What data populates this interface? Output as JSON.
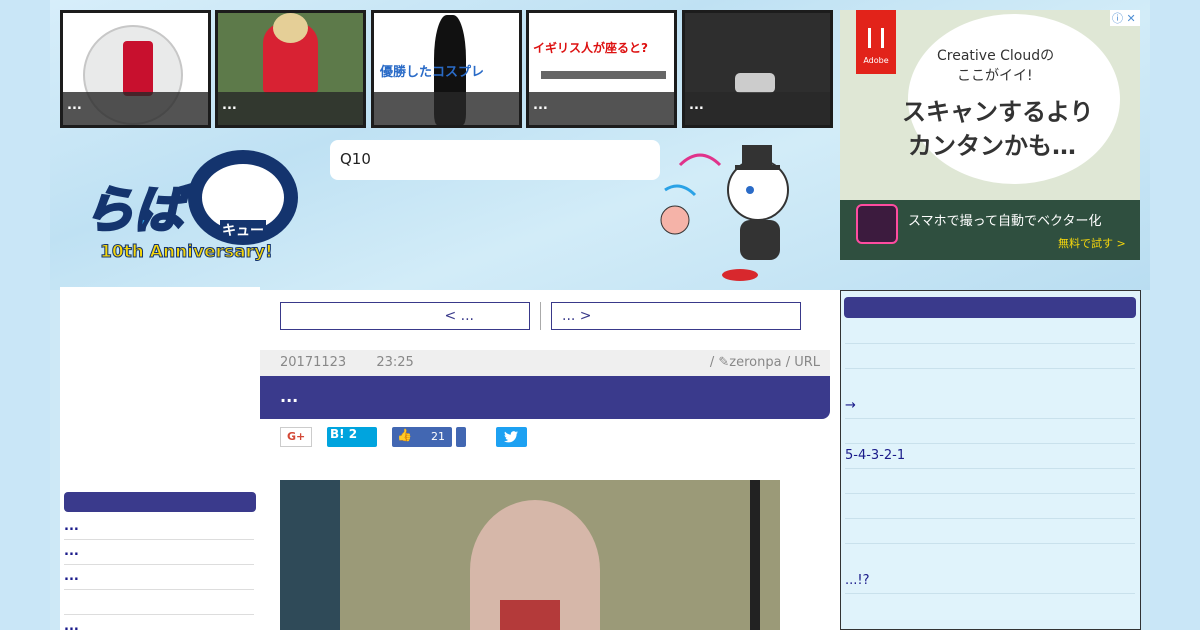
{
  "thumbs": [
    {
      "caption": "..."
    },
    {
      "caption": "..."
    },
    {
      "caption": "",
      "banner": "優勝したコスプレ"
    },
    {
      "caption": "...",
      "banner": "イギリス人が座ると?"
    },
    {
      "caption": "..."
    }
  ],
  "search": {
    "text": "Q10"
  },
  "logo": {
    "main": "らば",
    "q": "Q",
    "kana": "キュー",
    "anniv": "10th Anniversary!"
  },
  "ad": {
    "brand": "Adobe",
    "bubble1": "Creative Cloudの",
    "bubble2": "ここがイイ!",
    "headline1": "スキャンするより",
    "headline2": "カンタンかも…",
    "bottom": "スマホで撮って自動でベクター化",
    "cta": "無料で試す >",
    "close_info": "ⓘ",
    "close_x": "✕"
  },
  "nav": {
    "prev": "< ...",
    "next": "... >"
  },
  "article": {
    "date": "20171123",
    "time": "23:25",
    "meta": "/ ✎zeronpa / URL",
    "title": "..."
  },
  "share": {
    "gplus": "G+",
    "hatena": "B! 2",
    "like_count": "21"
  },
  "left_sidebar": {
    "items": [
      "...",
      "...",
      "...",
      "",
      "..."
    ]
  },
  "right_sidebar": {
    "items": [
      "",
      "",
      "→",
      "",
      "5-4-3-2-1",
      "",
      "",
      "",
      "...!?"
    ]
  },
  "colors": {
    "accent": "#3a3a8c",
    "link": "#1a1a8a",
    "twitter": "#1da1f2",
    "facebook": "#4267b2",
    "hatena": "#00a4de"
  }
}
